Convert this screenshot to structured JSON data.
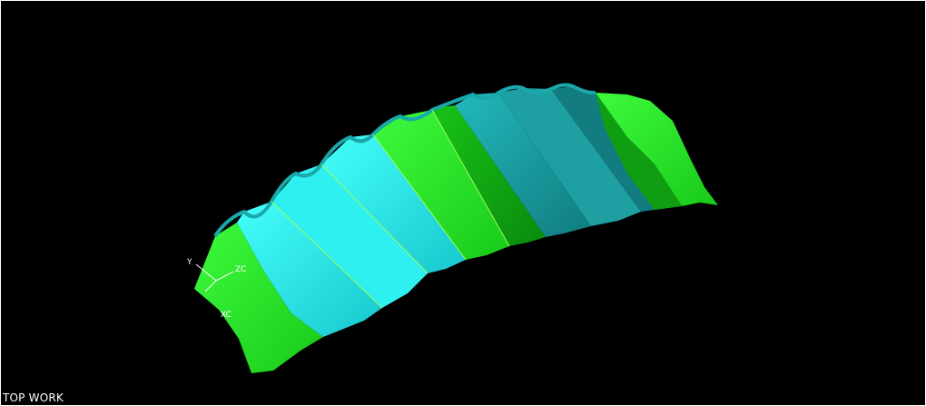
{
  "viewport": {
    "view_label": "TOP WORK",
    "background": "#000000",
    "border_color": "#ffffff"
  },
  "model": {
    "colors": {
      "green_light": "#2bf52b",
      "green": "#22dd22",
      "green_dark": "#0e9e12",
      "cyan_light": "#28f4f2",
      "cyan": "#22d6d8",
      "cyan_dark": "#138a8a",
      "edge": "#9dff5a"
    }
  },
  "triad": {
    "y_label": "Y",
    "zc_label": "ZC",
    "xc_label": "XC"
  }
}
